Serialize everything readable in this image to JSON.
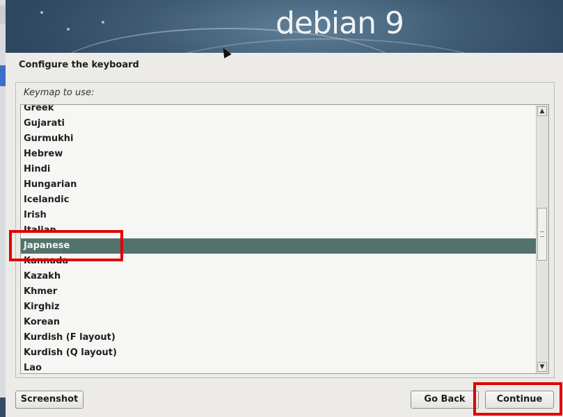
{
  "banner": {
    "title": "debian 9"
  },
  "page": {
    "title": "Configure the keyboard"
  },
  "keymap": {
    "label": "Keymap to use:",
    "items": [
      "Greek",
      "Gujarati",
      "Gurmukhi",
      "Hebrew",
      "Hindi",
      "Hungarian",
      "Icelandic",
      "Irish",
      "Italian",
      "Japanese",
      "Kannada",
      "Kazakh",
      "Khmer",
      "Kirghiz",
      "Korean",
      "Kurdish (F layout)",
      "Kurdish (Q layout)",
      "Lao"
    ],
    "selected": "Japanese"
  },
  "buttons": {
    "screenshot": "Screenshot",
    "go_back": "Go Back",
    "continue": "Continue"
  },
  "colors": {
    "selection": "#52736b",
    "highlight": "#e00000",
    "banner": "#3f5b73"
  }
}
